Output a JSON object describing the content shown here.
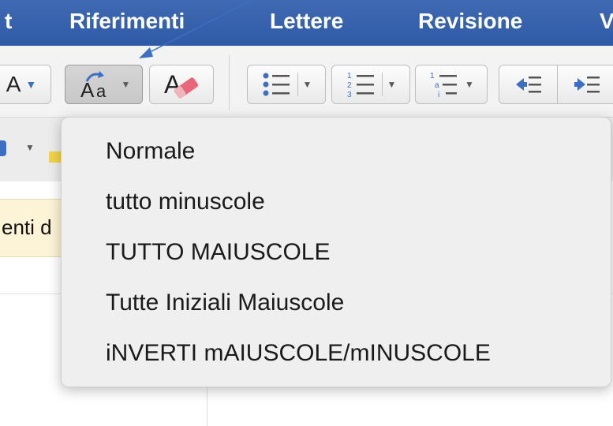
{
  "ribbon": {
    "tabs": [
      {
        "label": "t"
      },
      {
        "label": "Riferimenti"
      },
      {
        "label": "Lettere"
      },
      {
        "label": "Revisione"
      },
      {
        "label": "V"
      }
    ]
  },
  "toolbar": {
    "font_color_label": "A",
    "change_case_icon": "change-case-icon",
    "clear_format_icon": "clear-formatting-icon"
  },
  "document": {
    "hint_text": "enti d"
  },
  "change_case_menu": {
    "items": [
      {
        "label": "Normale"
      },
      {
        "label": "tutto minuscole"
      },
      {
        "label": "TUTTO MAIUSCOLE"
      },
      {
        "label": "Tutte Iniziali Maiuscole"
      },
      {
        "label": "iNVERTI mAIUSCOLE/mINUSCOLE"
      }
    ]
  },
  "colors": {
    "ribbon_blue": "#2f5aa7",
    "annotation_arrow": "#3c6fc4"
  }
}
